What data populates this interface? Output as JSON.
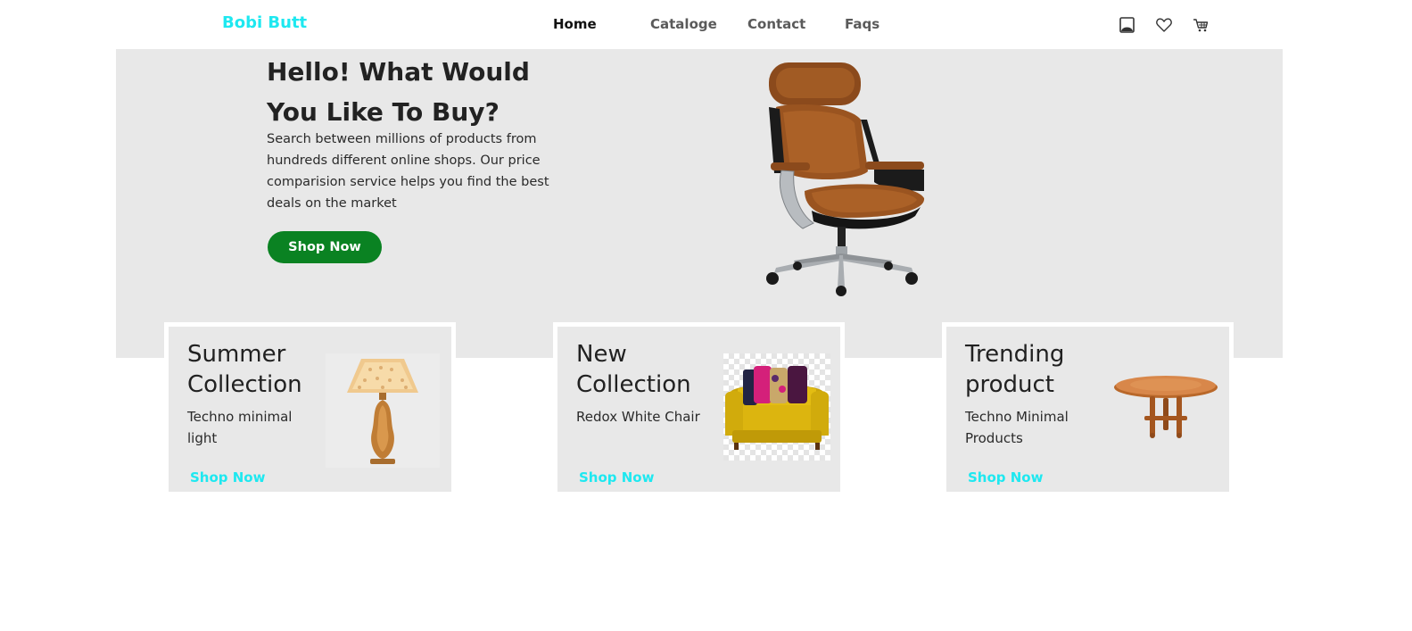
{
  "brand": "Bobi Butt",
  "nav": {
    "links": [
      "Home",
      "Cataloge",
      "Contact",
      "Faqs"
    ],
    "active": "Home",
    "icons": [
      "user-icon",
      "heart-icon",
      "cart-icon"
    ]
  },
  "hero": {
    "title": "Hello! What Would You Like To Buy?",
    "description": "Search between millions of products from hundreds different online shops. Our price comparision service helps you find the best deals on the market",
    "button": "Shop Now",
    "image": "office-chair-image"
  },
  "cards": [
    {
      "title": "Summer Collection",
      "subtitle": "Techno minimal light",
      "link": "Shop Now",
      "image": "lamp-image"
    },
    {
      "title": "New Collection",
      "subtitle": "Redox White Chair",
      "link": "Shop Now",
      "image": "yellow-sofa-image"
    },
    {
      "title": "Trending product",
      "subtitle": "Techno Minimal Products",
      "link": "Shop Now",
      "image": "table-image"
    }
  ],
  "colors": {
    "brand": "#1ee8f0",
    "button": "#0a8222",
    "panel": "#e8e8e8",
    "link": "#1ee8f0"
  }
}
